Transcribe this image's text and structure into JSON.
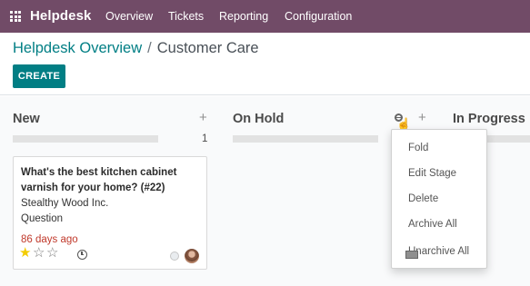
{
  "navbar": {
    "app_name": "Helpdesk",
    "menu": [
      "Overview",
      "Tickets",
      "Reporting",
      "Configuration"
    ],
    "bg_color": "#714b67"
  },
  "control_panel": {
    "breadcrumb_parent": "Helpdesk Overview",
    "breadcrumb_separator": "/",
    "breadcrumb_current": "Customer Care",
    "create_label": "CREATE",
    "accent_color": "#017e84"
  },
  "kanban": {
    "columns": [
      {
        "title": "New",
        "add": "+",
        "count": "1"
      },
      {
        "title": "On Hold",
        "add": "+"
      },
      {
        "title": "In Progress"
      }
    ]
  },
  "card": {
    "title": "What's the best kitchen cabinet varnish for your home? (#22)",
    "company": "Stealthy Wood Inc.",
    "type": "Question",
    "date": "86 days ago",
    "priority_stars": 1,
    "priority_max": 3,
    "star_full": "★",
    "star_empty": "☆"
  },
  "stage_menu": {
    "items": [
      "Fold",
      "Edit Stage",
      "Delete",
      "Archive All",
      "Unarchive All"
    ]
  },
  "icons": {
    "cursor": "☝"
  }
}
